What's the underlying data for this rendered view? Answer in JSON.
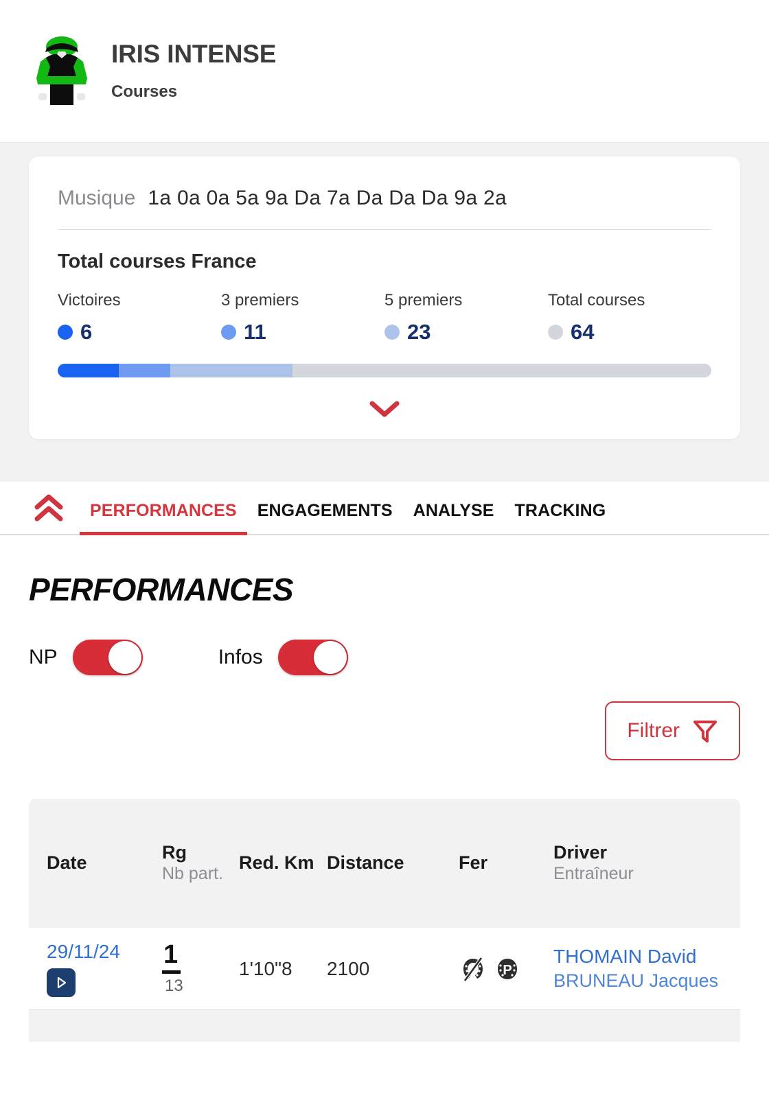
{
  "header": {
    "silks_icon": "jockey-silks-icon",
    "horse_name": "IRIS INTENSE",
    "subtitle": "Courses",
    "silks_colors": {
      "cap": "#14b814",
      "body": "#0d0d0d",
      "band": "#14b814",
      "sleeves": "#14b814",
      "collar": "#e8e8e8"
    }
  },
  "card": {
    "musique_label": "Musique",
    "musique_value": "1a 0a 0a 5a 9a Da 7a Da Da Da 9a 2a",
    "stats_title": "Total courses France",
    "stats": [
      {
        "label": "Victoires",
        "value": "6",
        "color": "#1a63f0",
        "pct": 9.4
      },
      {
        "label": "3 premiers",
        "value": "11",
        "color": "#6e9af0",
        "pct": 17.2
      },
      {
        "label": "5 premiers",
        "value": "23",
        "color": "#adc3ea",
        "pct": 35.9
      },
      {
        "label": "Total courses",
        "value": "64",
        "color": "#d4d6de",
        "pct": 100
      }
    ],
    "expand_icon": "chevron-down-icon",
    "expand_color": "#cf353e"
  },
  "tabs": {
    "scroll_icon": "double-chevron-up-icon",
    "items": [
      {
        "label": "PERFORMANCES",
        "active": true
      },
      {
        "label": "ENGAGEMENTS",
        "active": false
      },
      {
        "label": "ANALYSE",
        "active": false
      },
      {
        "label": "TRACKING",
        "active": false
      }
    ],
    "accent_color": "#d6373f"
  },
  "performances": {
    "title": "PERFORMANCES",
    "toggles": [
      {
        "label": "NP",
        "on": true
      },
      {
        "label": "Infos",
        "on": true
      }
    ],
    "filter_button": {
      "label": "Filtrer",
      "icon": "funnel-icon"
    },
    "table": {
      "headers": [
        {
          "main": "Date",
          "sub": ""
        },
        {
          "main": "Rg",
          "sub": "Nb part."
        },
        {
          "main": "Red. Km",
          "sub": ""
        },
        {
          "main": "Distance",
          "sub": ""
        },
        {
          "main": "Fer",
          "sub": ""
        },
        {
          "main": "Driver",
          "sub": "Entraîneur"
        }
      ],
      "rows": [
        {
          "date": "29/11/24",
          "video_icon": "play-icon",
          "rank": "1",
          "nb_part": "13",
          "red_km": "1'10\"8",
          "distance": "2100",
          "fer_icons": [
            "horseshoe-crossed-icon",
            "horseshoe-p-icon"
          ],
          "driver": "THOMAIN David",
          "trainer": "BRUNEAU Jacques"
        }
      ]
    }
  }
}
